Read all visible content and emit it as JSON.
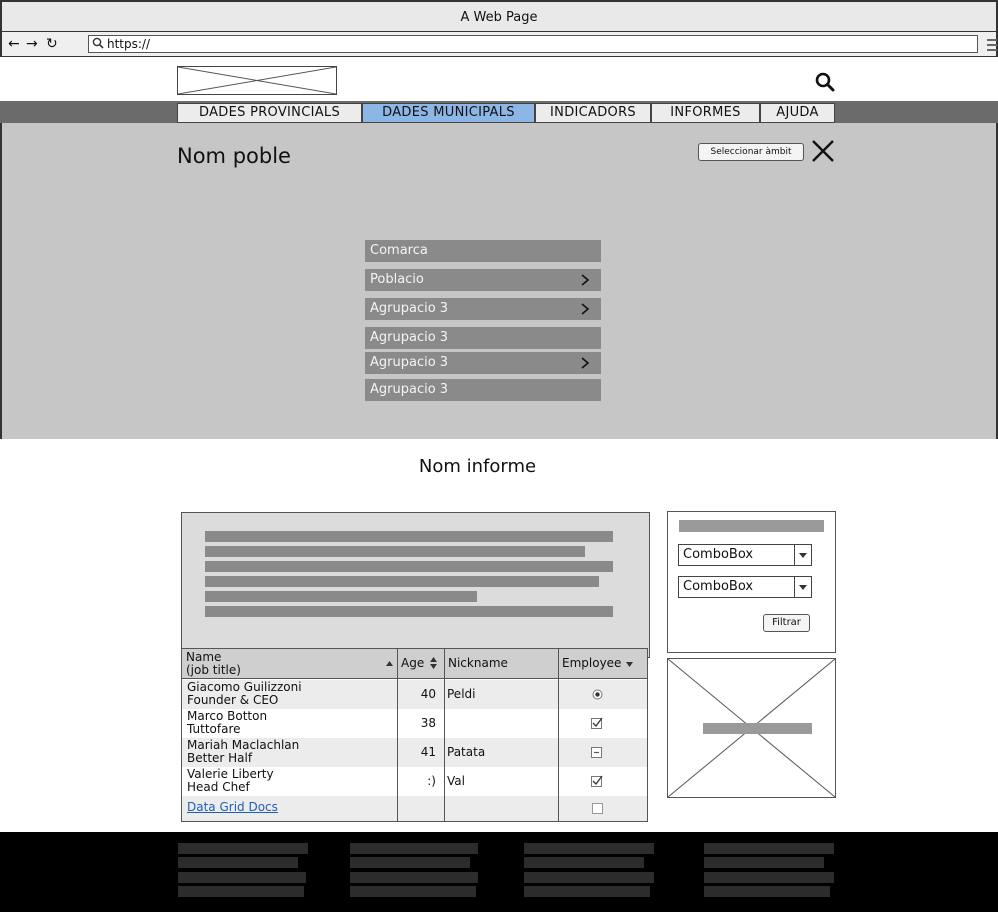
{
  "browser": {
    "title": "A Web Page",
    "url": "https://"
  },
  "header": {
    "tabs": [
      {
        "label": "DADES PROVINCIALS",
        "active": false
      },
      {
        "label": "DADES MUNICIPALS",
        "active": true
      },
      {
        "label": "INDICADORS",
        "active": false
      },
      {
        "label": "INFORMES",
        "active": false
      },
      {
        "label": "AJUDA",
        "active": false
      }
    ]
  },
  "scope": {
    "title": "Nom poble",
    "select_button": "Seleccionar àmbit",
    "menu": [
      {
        "label": "Comarca",
        "has_submenu": false
      },
      {
        "label": "Poblacio",
        "has_submenu": true
      },
      {
        "label": "Agrupacio 3",
        "has_submenu": true
      },
      {
        "label": "Agrupacio 3",
        "has_submenu": false
      },
      {
        "label": "Agrupacio 3",
        "has_submenu": true
      },
      {
        "label": "Agrupacio 3",
        "has_submenu": false
      }
    ]
  },
  "report": {
    "title": "Nom informe"
  },
  "filters": {
    "combo1": "ComboBox",
    "combo2": "ComboBox",
    "button": "Filtrar"
  },
  "grid": {
    "headers": {
      "name": "Name",
      "name_sub": "(job title)",
      "age": "Age",
      "nickname": "Nickname",
      "employee": "Employee"
    },
    "rows": [
      {
        "name": "Giacomo Guilizzoni",
        "title": "Founder & CEO",
        "age": "40",
        "nickname": "Peldi",
        "employee": "radio"
      },
      {
        "name": "Marco Botton",
        "title": "Tuttofare",
        "age": "38",
        "nickname": "",
        "employee": "checked"
      },
      {
        "name": "Mariah Maclachlan",
        "title": "Better Half",
        "age": "41",
        "nickname": "Patata",
        "employee": "indeterminate"
      },
      {
        "name": "Valerie Liberty",
        "title": "Head Chef",
        "age": ":)",
        "nickname": "Val",
        "employee": "checked"
      }
    ],
    "footer_link": "Data Grid Docs"
  }
}
